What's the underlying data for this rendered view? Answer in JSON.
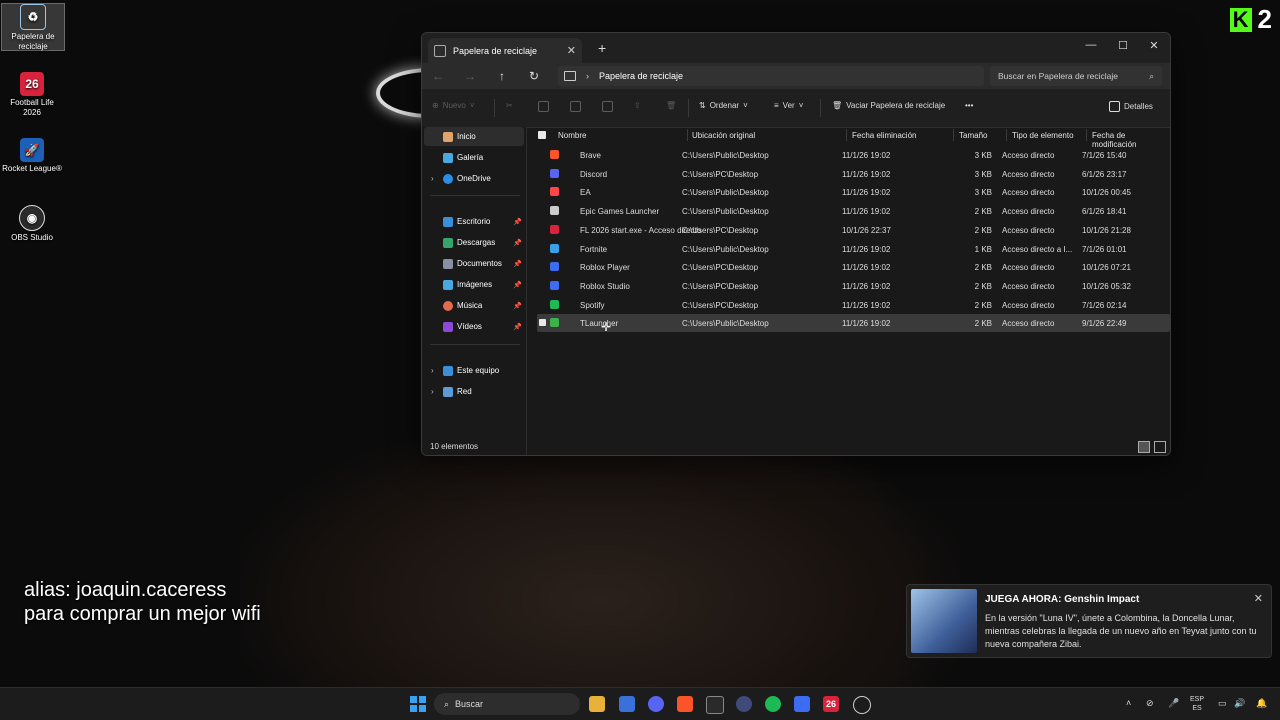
{
  "desktop": {
    "icons": [
      {
        "label": "Papelera de reciclaje",
        "icon": "recycle-bin-icon"
      },
      {
        "label": "Football Life 2026",
        "icon": "football-life-icon",
        "glyph": "26"
      },
      {
        "label": "Rocket League®",
        "icon": "rocket-league-icon"
      },
      {
        "label": "OBS Studio",
        "icon": "obs-icon"
      }
    ],
    "brand_digit": "2",
    "brand_letter": "K",
    "overlay_line1": "alias: joaquin.caceress",
    "overlay_line2": "para comprar un mejor wifi"
  },
  "window": {
    "tab_title": "Papelera de reciclaje",
    "tab_close": "✕",
    "new_tab": "+",
    "controls": {
      "minimize": "—",
      "maximize": "☐",
      "close": "✕"
    },
    "path_segment": "Papelera de reciclaje",
    "search_placeholder": "Buscar en Papelera de reciclaje",
    "toolbar": {
      "new_label": "Nuevo",
      "sort_label": "Ordenar",
      "view_label": "Ver",
      "empty_label": "Vaciar Papelera de reciclaje",
      "more_label": "•••",
      "details_label": "Detalles"
    },
    "nav": {
      "home": "Inicio",
      "gallery": "Galería",
      "onedrive": "OneDrive",
      "desktop": "Escritorio",
      "downloads": "Descargas",
      "documents": "Documentos",
      "pictures": "Imágenes",
      "music": "Música",
      "videos": "Vídeos",
      "this_pc": "Este equipo",
      "network": "Red"
    },
    "columns": {
      "name": "Nombre",
      "origin": "Ubicación original",
      "deleted": "Fecha eliminación",
      "size": "Tamaño",
      "type": "Tipo de elemento",
      "modified": "Fecha de modificación"
    },
    "rows": [
      {
        "name": "Brave",
        "origin": "C:\\Users\\Public\\Desktop",
        "deleted": "11/1/26 19:02",
        "size": "3 KB",
        "type": "Acceso directo",
        "modified": "7/1/26 15:40",
        "color": "#fb542b"
      },
      {
        "name": "Discord",
        "origin": "C:\\Users\\PC\\Desktop",
        "deleted": "11/1/26 19:02",
        "size": "3 KB",
        "type": "Acceso directo",
        "modified": "6/1/26 23:17",
        "color": "#5865f2"
      },
      {
        "name": "EA",
        "origin": "C:\\Users\\Public\\Desktop",
        "deleted": "11/1/26 19:02",
        "size": "3 KB",
        "type": "Acceso directo",
        "modified": "10/1/26 00:45",
        "color": "#ff4747"
      },
      {
        "name": "Epic Games Launcher",
        "origin": "C:\\Users\\Public\\Desktop",
        "deleted": "11/1/26 19:02",
        "size": "2 KB",
        "type": "Acceso directo",
        "modified": "6/1/26 18:41",
        "color": "#cccccc"
      },
      {
        "name": "FL 2026 start.exe - Acceso directo",
        "origin": "C:\\Users\\PC\\Desktop",
        "deleted": "10/1/26 22:37",
        "size": "2 KB",
        "type": "Acceso directo",
        "modified": "10/1/26 21:28",
        "color": "#d9233c"
      },
      {
        "name": "Fortnite",
        "origin": "C:\\Users\\Public\\Desktop",
        "deleted": "11/1/26 19:02",
        "size": "1 KB",
        "type": "Acceso directo a I...",
        "modified": "7/1/26 01:01",
        "color": "#3aa0e8"
      },
      {
        "name": "Roblox Player",
        "origin": "C:\\Users\\PC\\Desktop",
        "deleted": "11/1/26 19:02",
        "size": "2 KB",
        "type": "Acceso directo",
        "modified": "10/1/26 07:21",
        "color": "#3d6bf2"
      },
      {
        "name": "Roblox Studio",
        "origin": "C:\\Users\\PC\\Desktop",
        "deleted": "11/1/26 19:02",
        "size": "2 KB",
        "type": "Acceso directo",
        "modified": "10/1/26 05:32",
        "color": "#3d6bf2"
      },
      {
        "name": "Spotify",
        "origin": "C:\\Users\\PC\\Desktop",
        "deleted": "11/1/26 19:02",
        "size": "2 KB",
        "type": "Acceso directo",
        "modified": "7/1/26 02:14",
        "color": "#1db954"
      },
      {
        "name": "TLauncher",
        "origin": "C:\\Users\\Public\\Desktop",
        "deleted": "11/1/26 19:02",
        "size": "2 KB",
        "type": "Acceso directo",
        "modified": "9/1/26 22:49",
        "color": "#3bb34a"
      }
    ],
    "status": "10 elementos"
  },
  "notification": {
    "title": "JUEGA AHORA: Genshin Impact",
    "body": "En la versión \"Luna IV\", únete a Colombina, la Doncella Lunar, mientras celebras la llegada de un nuevo año en Teyvat junto con tu nueva compañera Zibai.",
    "close": "✕"
  },
  "taskbar": {
    "search_label": "Buscar",
    "football_glyph": "26",
    "lang_top": "ESP",
    "lang_bottom": "ES"
  }
}
